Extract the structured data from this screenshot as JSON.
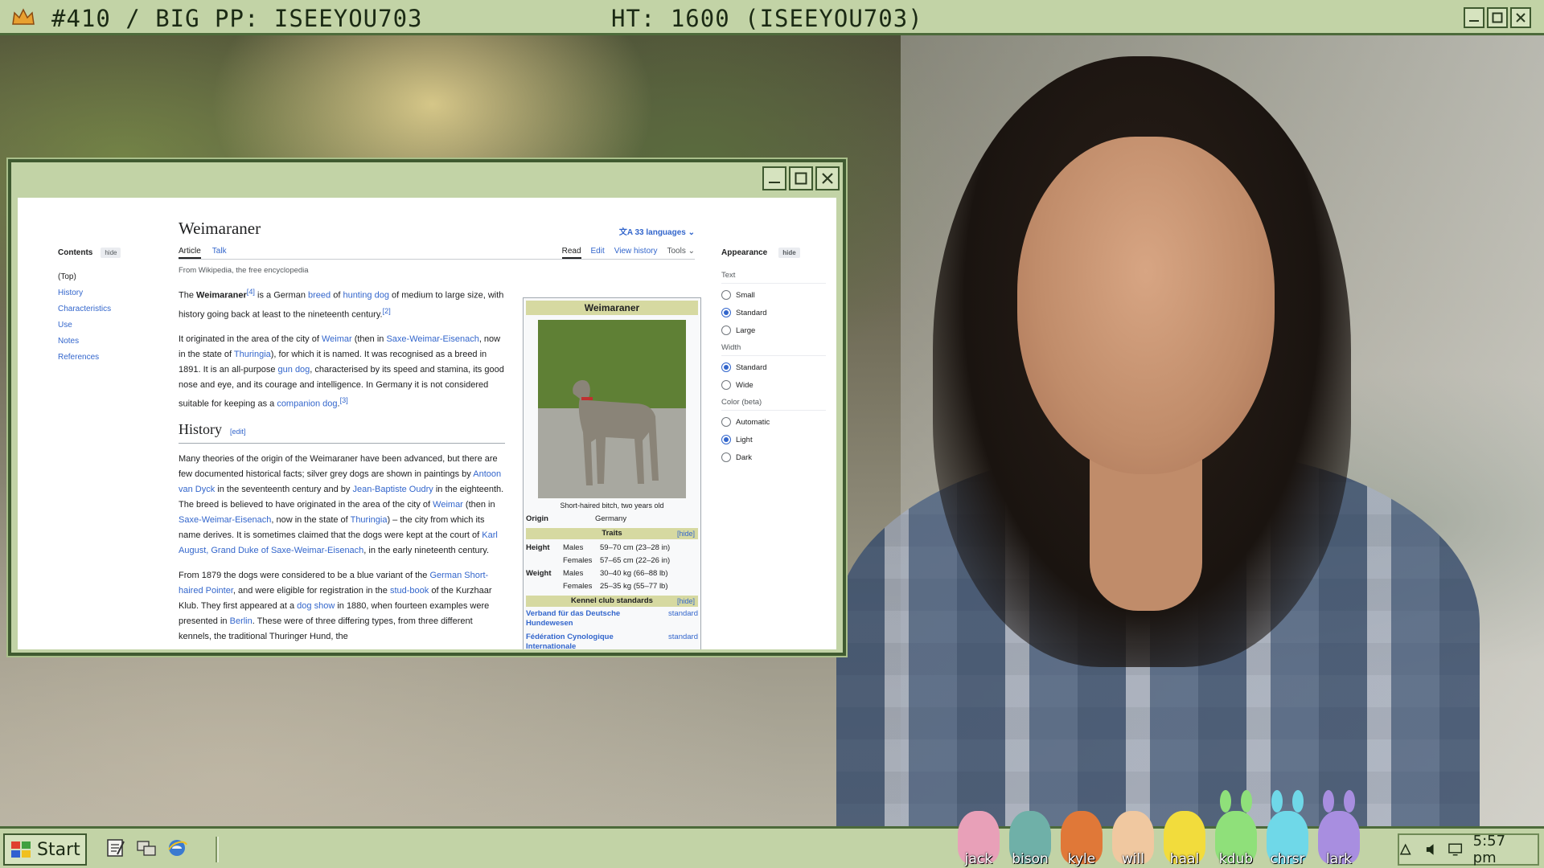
{
  "stream": {
    "top_left": "#410 / BIG PP: ISEEYOU703",
    "top_center": "HT: 1600 (ISEEYOU703)"
  },
  "window_buttons": {
    "minimize": "_",
    "maximize": "□",
    "close": "X"
  },
  "wiki": {
    "title": "Weimaraner",
    "languages": "33 languages",
    "tabs_left": [
      "Article",
      "Talk"
    ],
    "tabs_right": [
      "Read",
      "Edit",
      "View history",
      "Tools"
    ],
    "from": "From Wikipedia, the free encyclopedia",
    "toc": {
      "title": "Contents",
      "hide": "hide",
      "items": [
        "(Top)",
        "History",
        "Characteristics",
        "Use",
        "Notes",
        "References"
      ]
    },
    "intro": {
      "p1_a": "The ",
      "p1_b": "Weimaraner",
      "p1_c": " is a German ",
      "p1_breed": "breed",
      "p1_d": " of ",
      "p1_hunting": "hunting dog",
      "p1_e": " of medium to large size, with history going back at least to the nineteenth century.",
      "p2_a": "It originated in the area of the city of ",
      "p2_weimar": "Weimar",
      "p2_b": " (then in ",
      "p2_saxe": "Saxe-Weimar-Eisenach",
      "p2_c": ", now in the state of ",
      "p2_thur": "Thuringia",
      "p2_d": "), for which it is named. It was recognised as a breed in 1891. It is an all-purpose ",
      "p2_gun": "gun dog",
      "p2_e": ", characterised by its speed and stamina, its good nose and eye, and its courage and intelligence. In Germany it is not considered suitable for keeping as a ",
      "p2_comp": "companion dog",
      "p2_f": "."
    },
    "history": {
      "heading": "History",
      "edit": "[edit]",
      "p1_a": "Many theories of the origin of the Weimaraner have been advanced, but there are few documented historical facts; silver grey dogs are shown in paintings by ",
      "p1_van": "Antoon van Dyck",
      "p1_b": " in the seventeenth century and by ",
      "p1_oudry": "Jean-Baptiste Oudry",
      "p1_c": " in the eighteenth. The breed is believed to have originated in the area of the city of ",
      "p1_weimar": "Weimar",
      "p1_d": " (then in ",
      "p1_saxe": "Saxe-Weimar-Eisenach",
      "p1_e": ", now in the state of ",
      "p1_thur": "Thuringia",
      "p1_f": ") – the city from which its name derives. It is sometimes claimed that the dogs were kept at the court of ",
      "p1_karl": "Karl August, Grand Duke of Saxe-Weimar-Eisenach",
      "p1_g": ", in the early nineteenth century.",
      "p2_a": "From 1879 the dogs were considered to be a blue variant of the ",
      "p2_gsp": "German Short-haired Pointer",
      "p2_b": ", and were eligible for registration in the ",
      "p2_stud": "stud-book",
      "p2_c": " of the Kurzhaar Klub. They first appeared at a ",
      "p2_show": "dog show",
      "p2_d": " in 1880, when fourteen examples were presented in ",
      "p2_berlin": "Berlin",
      "p2_e": ". These were of three differing types, from three different kennels, the traditional Thuringer Hund, the"
    },
    "infobox": {
      "title": "Weimaraner",
      "caption": "Short-haired bitch, two years old",
      "origin_label": "Origin",
      "origin_value": "Germany",
      "traits_label": "Traits",
      "hide": "[hide]",
      "height_label": "Height",
      "weight_label": "Weight",
      "males": "Males",
      "females": "Females",
      "height_m": "59–70 cm (23–28 in)",
      "height_f": "57–65 cm (22–26 in)",
      "weight_m": "30–40 kg (66–88 lb)",
      "weight_f": "25–35 kg (55–77 lb)",
      "kennel_label": "Kennel club standards",
      "kc1_name": "Verband für das Deutsche Hundewesen",
      "kc1_link": "standard",
      "kc2_name": "Fédération Cynologique Internationale",
      "kc2_link": "standard"
    },
    "appearance": {
      "title": "Appearance",
      "hide": "hide",
      "text_label": "Text",
      "text_options": [
        "Small",
        "Standard",
        "Large"
      ],
      "text_selected": 1,
      "width_label": "Width",
      "width_options": [
        "Standard",
        "Wide"
      ],
      "width_selected": 0,
      "color_label": "Color (beta)",
      "color_options": [
        "Automatic",
        "Light",
        "Dark"
      ],
      "color_selected": 1
    }
  },
  "taskbar": {
    "start": "Start",
    "clock": "5:57 pm",
    "peeps": [
      {
        "name": "jack",
        "color": "#e8a0b8"
      },
      {
        "name": "bison",
        "color": "#6fb0a8"
      },
      {
        "name": "kyle",
        "color": "#e07838"
      },
      {
        "name": "will",
        "color": "#f0c8a0"
      },
      {
        "name": "haal",
        "color": "#f2dc3c"
      },
      {
        "name": "kdub",
        "color": "#8fe07a"
      },
      {
        "name": "chrsr",
        "color": "#6fd8e8"
      },
      {
        "name": "lark",
        "color": "#a88ee0"
      }
    ]
  },
  "colors": {
    "chrome_green": "#c2d3a6",
    "chrome_border": "#3f5a30",
    "link_blue": "#3366cc"
  }
}
